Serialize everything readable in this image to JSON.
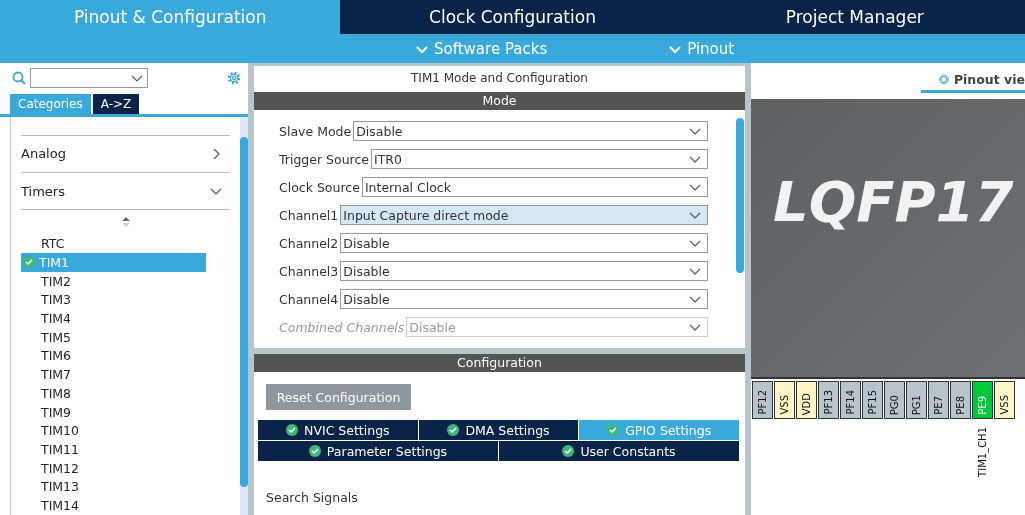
{
  "top_tabs": [
    {
      "label": "Pinout & Configuration",
      "selected": true
    },
    {
      "label": "Clock Configuration",
      "selected": false
    },
    {
      "label": "Project Manager",
      "selected": false
    }
  ],
  "sub_menu": [
    {
      "label": "Software Packs"
    },
    {
      "label": "Pinout"
    }
  ],
  "sidebar": {
    "view_tabs": [
      {
        "label": "Categories",
        "selected": true
      },
      {
        "label": "A->Z",
        "selected": false
      }
    ],
    "categories": [
      {
        "label": "Analog",
        "expanded": false
      },
      {
        "label": "Timers",
        "expanded": true
      }
    ],
    "items": [
      {
        "label": "RTC",
        "selected": false,
        "enabled": false
      },
      {
        "label": "TIM1",
        "selected": true,
        "enabled": true
      },
      {
        "label": "TIM2",
        "selected": false,
        "enabled": false
      },
      {
        "label": "TIM3",
        "selected": false,
        "enabled": false
      },
      {
        "label": "TIM4",
        "selected": false,
        "enabled": false
      },
      {
        "label": "TIM5",
        "selected": false,
        "enabled": false
      },
      {
        "label": "TIM6",
        "selected": false,
        "enabled": false
      },
      {
        "label": "TIM7",
        "selected": false,
        "enabled": false
      },
      {
        "label": "TIM8",
        "selected": false,
        "enabled": false
      },
      {
        "label": "TIM9",
        "selected": false,
        "enabled": false
      },
      {
        "label": "TIM10",
        "selected": false,
        "enabled": false
      },
      {
        "label": "TIM11",
        "selected": false,
        "enabled": false
      },
      {
        "label": "TIM12",
        "selected": false,
        "enabled": false
      },
      {
        "label": "TIM13",
        "selected": false,
        "enabled": false
      },
      {
        "label": "TIM14",
        "selected": false,
        "enabled": false
      }
    ]
  },
  "mode_panel": {
    "title": "TIM1 Mode and Configuration",
    "header": "Mode",
    "fields": [
      {
        "label": "Slave Mode",
        "value": "Disable",
        "selected": false,
        "disabled": false
      },
      {
        "label": "Trigger Source",
        "value": "ITR0",
        "selected": false,
        "disabled": false
      },
      {
        "label": "Clock Source",
        "value": "Internal Clock",
        "selected": false,
        "disabled": false
      },
      {
        "label": "Channel1",
        "value": "Input Capture direct mode",
        "selected": true,
        "disabled": false
      },
      {
        "label": "Channel2",
        "value": "Disable",
        "selected": false,
        "disabled": false
      },
      {
        "label": "Channel3",
        "value": "Disable",
        "selected": false,
        "disabled": false
      },
      {
        "label": "Channel4",
        "value": "Disable",
        "selected": false,
        "disabled": false
      },
      {
        "label": "Combined Channels",
        "value": "Disable",
        "selected": false,
        "disabled": true
      }
    ]
  },
  "config_panel": {
    "header": "Configuration",
    "reset_button": "Reset Configuration",
    "tab_rows": [
      [
        {
          "label": "NVIC Settings",
          "selected": false
        },
        {
          "label": "DMA Settings",
          "selected": false
        },
        {
          "label": "GPIO Settings",
          "selected": true
        }
      ],
      [
        {
          "label": "Parameter Settings",
          "selected": false
        },
        {
          "label": "User Constants",
          "selected": false
        }
      ]
    ],
    "search_label": "Search Signals"
  },
  "pinout": {
    "view_tab": "Pinout vie",
    "chip_package": "LQFP17",
    "pins": [
      {
        "name": "PF12",
        "kind": "io"
      },
      {
        "name": "VSS",
        "kind": "power"
      },
      {
        "name": "VDD",
        "kind": "power"
      },
      {
        "name": "PF13",
        "kind": "io"
      },
      {
        "name": "PF14",
        "kind": "io"
      },
      {
        "name": "PF15",
        "kind": "io"
      },
      {
        "name": "PG0",
        "kind": "io"
      },
      {
        "name": "PG1",
        "kind": "io"
      },
      {
        "name": "PE7",
        "kind": "io"
      },
      {
        "name": "PE8",
        "kind": "io"
      },
      {
        "name": "PE9",
        "kind": "assigned",
        "signal": "TIM1_CH1"
      },
      {
        "name": "VSS",
        "kind": "power"
      }
    ]
  }
}
